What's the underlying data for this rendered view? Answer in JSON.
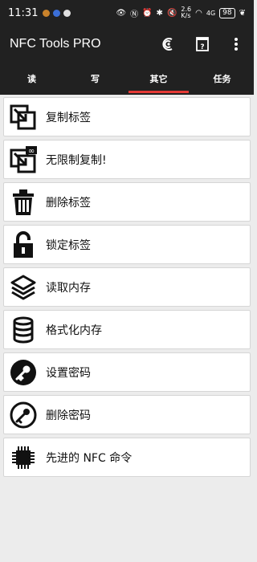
{
  "status_bar": {
    "time": "11:31",
    "network_speed": "2.6",
    "network_unit": "K/s",
    "signal": "4G",
    "battery": "98"
  },
  "app_bar": {
    "title": "NFC Tools PRO"
  },
  "tabs": [
    {
      "label": "读",
      "active": false
    },
    {
      "label": "写",
      "active": false
    },
    {
      "label": "其它",
      "active": true
    },
    {
      "label": "任务",
      "active": false
    }
  ],
  "menu_items": [
    {
      "label": "复制标签",
      "icon": "copy-tag-icon"
    },
    {
      "label": "无限制复制!",
      "icon": "unlimited-copy-icon"
    },
    {
      "label": "删除标签",
      "icon": "trash-icon"
    },
    {
      "label": "锁定标签",
      "icon": "lock-icon"
    },
    {
      "label": "读取内存",
      "icon": "layers-icon"
    },
    {
      "label": "格式化内存",
      "icon": "database-icon"
    },
    {
      "label": "设置密码",
      "icon": "key-icon"
    },
    {
      "label": "删除密码",
      "icon": "remove-key-icon"
    },
    {
      "label": "先进的 NFC 命令",
      "icon": "chip-icon"
    }
  ],
  "colors": {
    "bar": "#212121",
    "accent": "#e53935",
    "background": "#ececec"
  }
}
